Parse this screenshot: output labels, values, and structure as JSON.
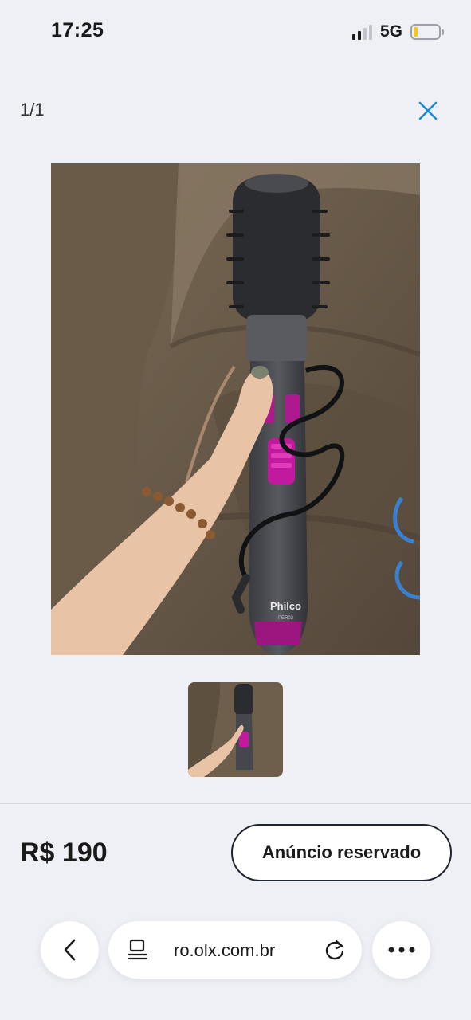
{
  "status_bar": {
    "time": "17:25",
    "network": "5G",
    "signal_bars_active": 2,
    "signal_bars_total": 4,
    "battery_level": 0.15,
    "battery_color": "#f3c623"
  },
  "gallery": {
    "counter": "1/1",
    "close_icon": "close-icon",
    "accent_color": "#1b8ad6",
    "photo": {
      "description_icon": "product-photo",
      "brand_text": "Philco",
      "model_text": "PER02"
    },
    "thumbnails": [
      {
        "icon": "product-thumbnail"
      }
    ]
  },
  "listing": {
    "price": "R$ 190",
    "reserved_label": "Anúncio reservado"
  },
  "browser": {
    "back_icon": "chevron-left-icon",
    "tabs_icon": "tabs-icon",
    "url": "ro.olx.com.br",
    "reload_icon": "reload-icon",
    "more_icon": "more-dots-icon"
  }
}
